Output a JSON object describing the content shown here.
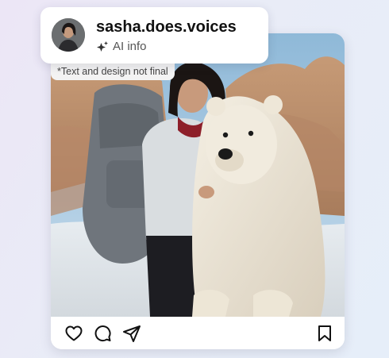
{
  "profile": {
    "username": "sasha.does.voices",
    "ai_info_label": "AI info",
    "ai_info_icon": "sparkle-icon",
    "avatar_icon": "avatar"
  },
  "disclaimer": "*Text and design not final",
  "post": {
    "image_description_icon": "post-photo",
    "actions": {
      "like_icon": "heart-icon",
      "comment_icon": "comment-bubble-icon",
      "share_icon": "paper-plane-icon",
      "save_icon": "bookmark-icon"
    }
  },
  "colors": {
    "icon_stroke": "#111111",
    "card_bg": "#ffffff",
    "disclaimer_bg": "#f3f3f3"
  }
}
